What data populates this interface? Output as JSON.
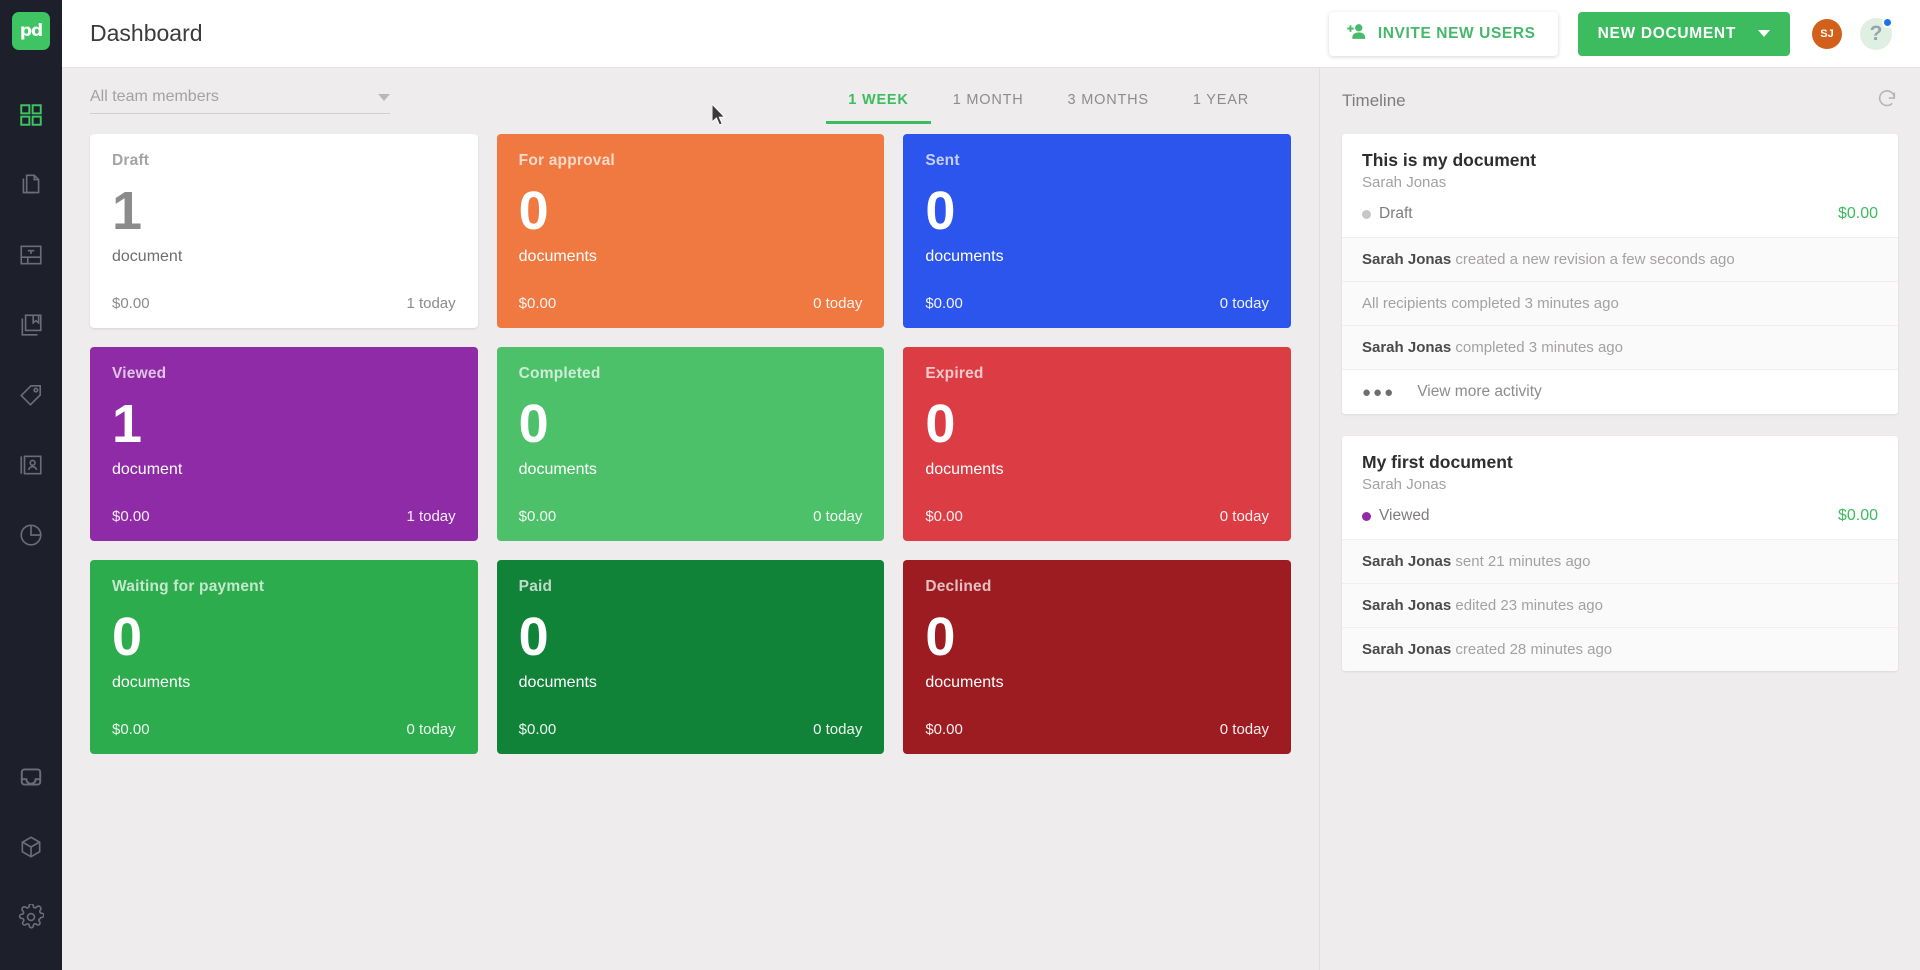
{
  "app": {
    "logo_text": "pd",
    "brand_green": "#3cbb5f"
  },
  "sidebar": {
    "items": [
      {
        "name": "dashboard",
        "icon": "grid-icon",
        "active": true
      },
      {
        "name": "documents",
        "icon": "documents-icon",
        "active": false
      },
      {
        "name": "templates",
        "icon": "template-icon",
        "active": false
      },
      {
        "name": "catalog",
        "icon": "book-icon",
        "active": false
      },
      {
        "name": "pricing",
        "icon": "tag-icon",
        "active": false
      },
      {
        "name": "contacts",
        "icon": "contact-card-icon",
        "active": false
      },
      {
        "name": "reports",
        "icon": "pie-chart-icon",
        "active": false
      }
    ],
    "bottom_items": [
      {
        "name": "inbox",
        "icon": "inbox-icon"
      },
      {
        "name": "integrations",
        "icon": "cube-icon"
      },
      {
        "name": "settings",
        "icon": "gear-icon"
      }
    ]
  },
  "header": {
    "title": "Dashboard",
    "invite_label": "INVITE NEW USERS",
    "new_document_label": "NEW DOCUMENT",
    "avatar_initials": "SJ",
    "help_label": "?"
  },
  "filters": {
    "team_select_value": "All team members",
    "range_tabs": [
      {
        "label": "1 WEEK",
        "active": true
      },
      {
        "label": "1 MONTH",
        "active": false
      },
      {
        "label": "3 MONTHS",
        "active": false
      },
      {
        "label": "1 YEAR",
        "active": false
      }
    ]
  },
  "stat_cards": [
    {
      "title": "Draft",
      "count": "1",
      "unit": "document",
      "amount": "$0.00",
      "today": "1 today",
      "color": "#ffffff",
      "style": "white"
    },
    {
      "title": "For approval",
      "count": "0",
      "unit": "documents",
      "amount": "$0.00",
      "today": "0 today",
      "color": "#ef7941",
      "style": "tinted"
    },
    {
      "title": "Sent",
      "count": "0",
      "unit": "documents",
      "amount": "$0.00",
      "today": "0 today",
      "color": "#2b55ec",
      "style": "tinted"
    },
    {
      "title": "Viewed",
      "count": "1",
      "unit": "document",
      "amount": "$0.00",
      "today": "1 today",
      "color": "#8f2ba6",
      "style": "tinted"
    },
    {
      "title": "Completed",
      "count": "0",
      "unit": "documents",
      "amount": "$0.00",
      "today": "0 today",
      "color": "#4cc16a",
      "style": "tinted"
    },
    {
      "title": "Expired",
      "count": "0",
      "unit": "documents",
      "amount": "$0.00",
      "today": "0 today",
      "color": "#dc3c44",
      "style": "tinted"
    },
    {
      "title": "Waiting for payment",
      "count": "0",
      "unit": "documents",
      "amount": "$0.00",
      "today": "0 today",
      "color": "#2cac4d",
      "style": "tinted"
    },
    {
      "title": "Paid",
      "count": "0",
      "unit": "documents",
      "amount": "$0.00",
      "today": "0 today",
      "color": "#118338",
      "style": "tinted"
    },
    {
      "title": "Declined",
      "count": "0",
      "unit": "documents",
      "amount": "$0.00",
      "today": "0 today",
      "color": "#9d1c22",
      "style": "tinted"
    }
  ],
  "timeline": {
    "heading": "Timeline",
    "refresh_icon": "refresh-icon",
    "cards": [
      {
        "doc_title": "This is my document",
        "author": "Sarah Jonas",
        "status": "Draft",
        "status_color": "#c8c6c6",
        "amount": "$0.00",
        "events": [
          {
            "actor": "Sarah Jonas",
            "text": " created a new revision a few seconds ago"
          },
          {
            "actor": "",
            "text": "All recipients completed 3 minutes ago"
          },
          {
            "actor": "Sarah Jonas",
            "text": " completed 3 minutes ago"
          }
        ],
        "more_label": "View more activity",
        "has_more": true
      },
      {
        "doc_title": "My first document",
        "author": "Sarah Jonas",
        "status": "Viewed",
        "status_color": "#8f2ba6",
        "amount": "$0.00",
        "events": [
          {
            "actor": "Sarah Jonas",
            "text": " sent 21 minutes ago"
          },
          {
            "actor": "Sarah Jonas",
            "text": " edited 23 minutes ago"
          },
          {
            "actor": "Sarah Jonas",
            "text": " created 28 minutes ago"
          }
        ],
        "more_label": "",
        "has_more": false
      }
    ]
  }
}
